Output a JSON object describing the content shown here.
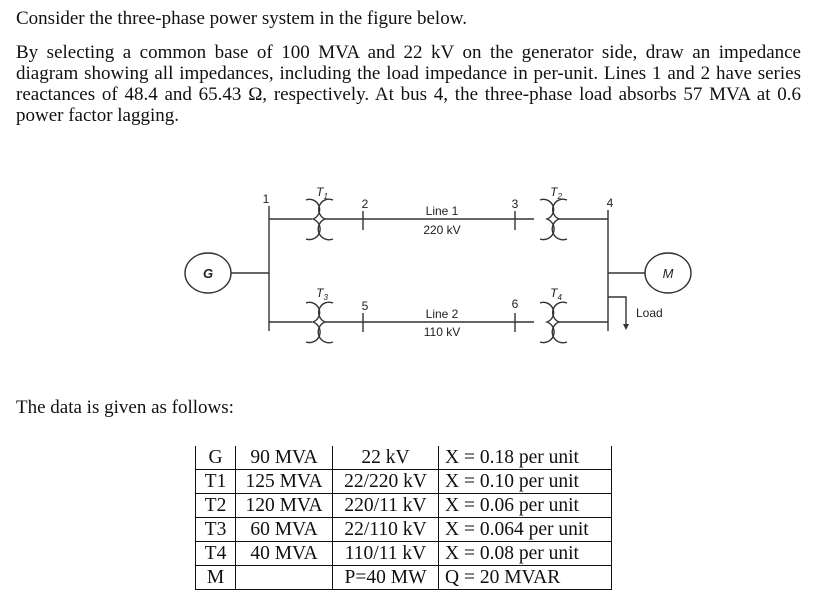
{
  "problem": {
    "intro": "Consider the three-phase power system in the figure below.",
    "statement": "By selecting a common base of 100 MVA and 22 kV on the generator side, draw an impedance diagram showing all impedances, including the load impedance in per-unit. Lines 1 and 2 have series reactances of 48.4 and 65.43 Ω, respectively. At bus 4, the three-phase load absorbs 57 MVA at 0.6 power factor lagging.",
    "data_intro": "The data is given as follows:"
  },
  "figure": {
    "generator_label": "G",
    "motor_label": "M",
    "load_label": "Load",
    "buses": {
      "b1": "1",
      "b2": "2",
      "b3": "3",
      "b4": "4",
      "b5": "5",
      "b6": "6"
    },
    "transformers": {
      "t1": {
        "name": "T",
        "sub": "1"
      },
      "t2": {
        "name": "T",
        "sub": "2"
      },
      "t3": {
        "name": "T",
        "sub": "3"
      },
      "t4": {
        "name": "T",
        "sub": "4"
      }
    },
    "line1": {
      "name": "Line 1",
      "voltage": "220 kV"
    },
    "line2": {
      "name": "Line 2",
      "voltage": "110 kV"
    }
  },
  "table": {
    "rows": [
      [
        "G",
        "90 MVA",
        "22 kV",
        "X = 0.18 per unit"
      ],
      [
        "T1",
        "125 MVA",
        "22/220 kV",
        "X = 0.10 per unit"
      ],
      [
        "T2",
        "120 MVA",
        "220/11 kV",
        "X = 0.06 per unit"
      ],
      [
        "T3",
        "60 MVA",
        "22/110 kV",
        "X = 0.064 per unit"
      ],
      [
        "T4",
        "40 MVA",
        "110/11 kV",
        "X = 0.08 per unit"
      ],
      [
        "M",
        "",
        "P=40 MW",
        "Q = 20 MVAR"
      ]
    ]
  }
}
